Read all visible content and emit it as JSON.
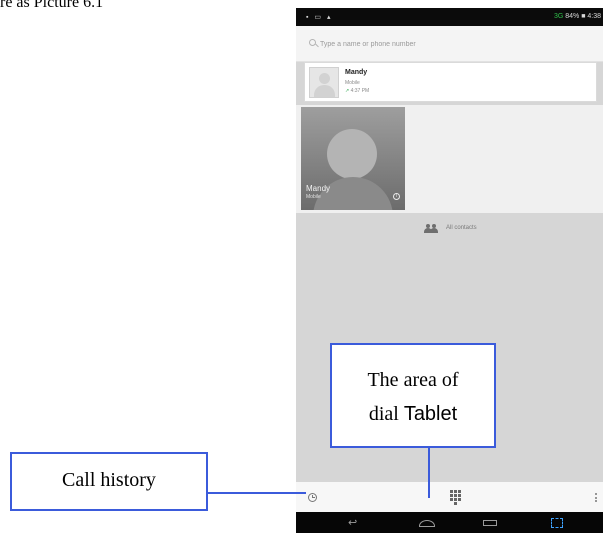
{
  "document": {
    "heading": "re as Picture 6.1"
  },
  "phone": {
    "status_bar": {
      "left_icons": "▪ ▭ ▴",
      "network": "3G",
      "right_text": "84% ■ 4:38"
    },
    "search": {
      "placeholder": "Type a name or phone number"
    },
    "recent_call": {
      "name": "Mandy",
      "type": "Mobile",
      "time": "4:37 PM"
    },
    "favorite": {
      "name": "Mandy",
      "type": "Mobile"
    },
    "all_contacts_label": "All contacts",
    "icons": {
      "history": "clock-icon",
      "dialpad": "dialpad-icon",
      "overflow": "overflow-menu-icon",
      "back": "back-icon",
      "home": "home-icon",
      "recents": "recent-apps-icon",
      "screenshot": "screenshot-icon"
    }
  },
  "callouts": {
    "dial_line1": "The area of",
    "dial_line2_part1": "dial",
    "dial_line2_part2": "Tablet",
    "history": "Call history"
  },
  "colors": {
    "callout_border": "#3b5bdb",
    "screenshot_highlight": "#3fa3ff"
  }
}
